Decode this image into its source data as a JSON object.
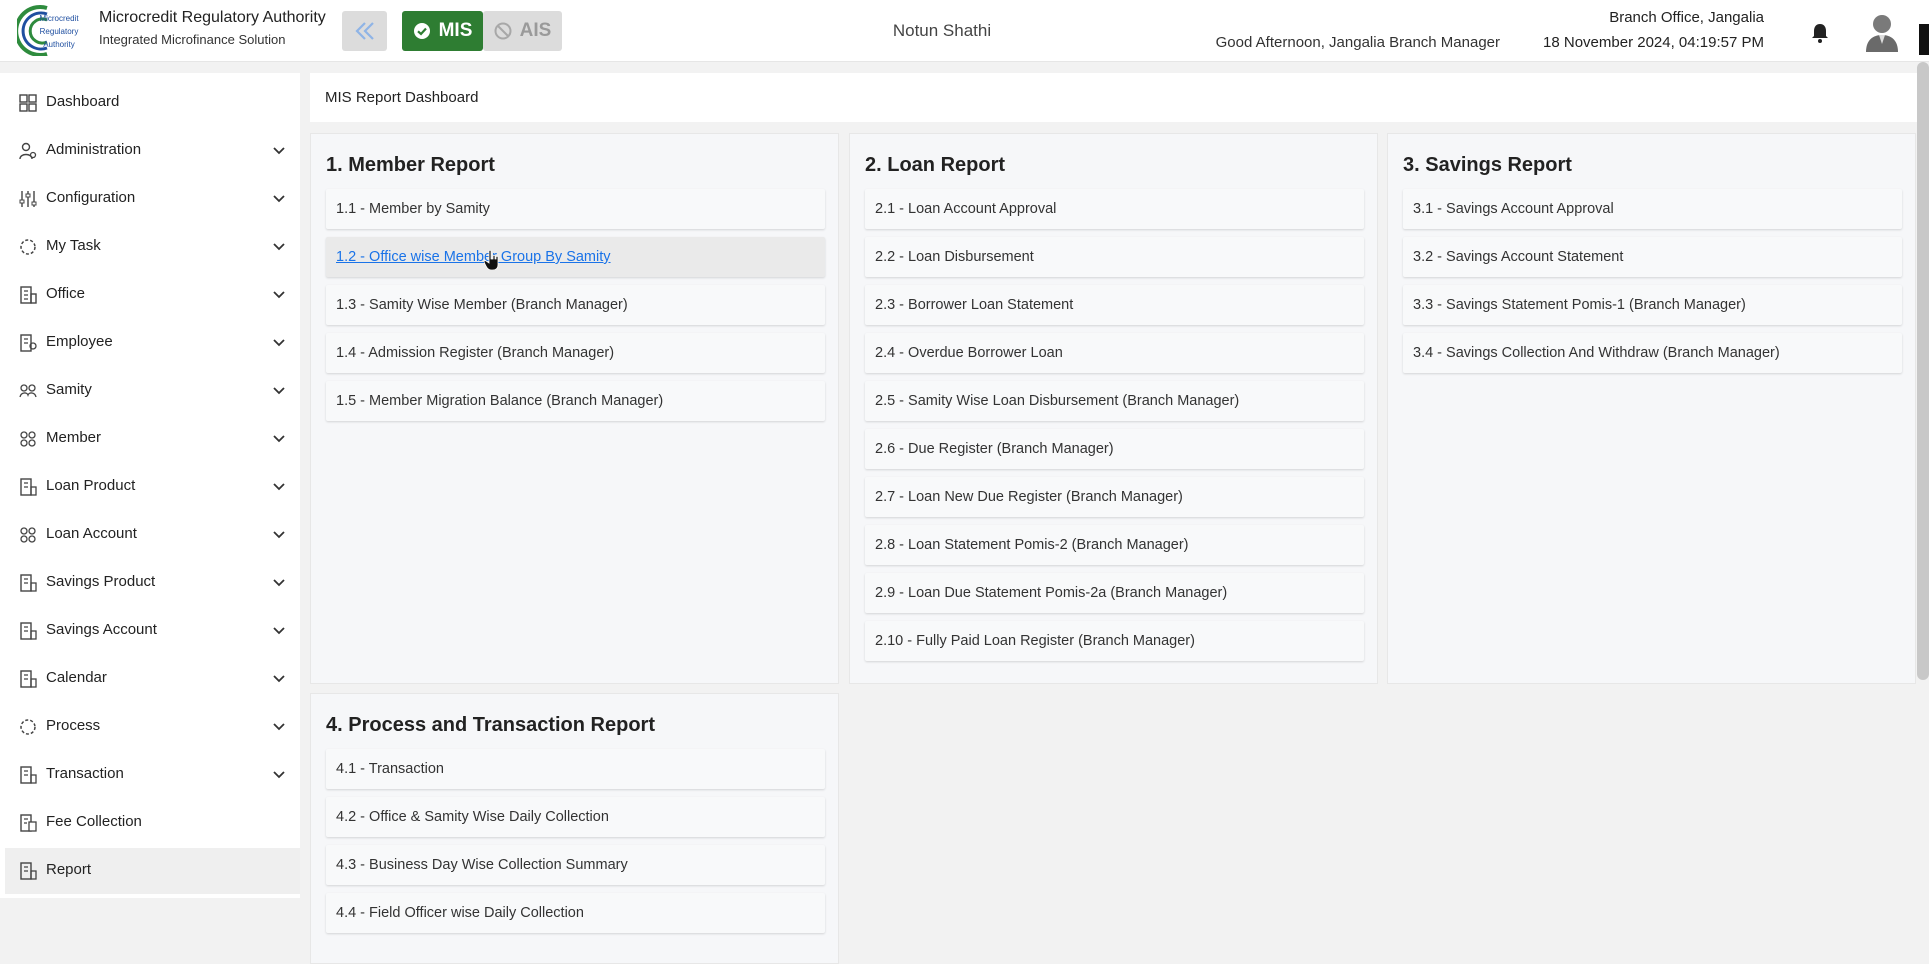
{
  "header": {
    "brand_title": "Microcredit Regulatory Authority",
    "brand_subtitle": "Integrated Microfinance Solution",
    "logo_text": "Microcredit Regulatory Authority",
    "mis_label": "MIS",
    "ais_label": "AIS",
    "org_name": "Notun Shathi",
    "greeting": "Good Afternoon, Jangalia Branch Manager",
    "branch_office": "Branch Office, Jangalia",
    "datetime": "18 November 2024, 04:19:57 PM",
    "icons": [
      "double-chevron-left-icon",
      "check-circle-icon",
      "ban-icon",
      "bell-icon",
      "user-avatar-icon"
    ],
    "colors": {
      "mis_active": "#2e7d32",
      "ais_inactive": "#dcdcdc",
      "logo_green": "#2e8b3d",
      "logo_blue": "#1f4fa0"
    }
  },
  "sidebar": {
    "items": [
      {
        "label": "Dashboard",
        "icon": "dashboard-icon",
        "expandable": false
      },
      {
        "label": "Administration",
        "icon": "admin-icon",
        "expandable": true
      },
      {
        "label": "Configuration",
        "icon": "sliders-icon",
        "expandable": true
      },
      {
        "label": "My Task",
        "icon": "task-icon",
        "expandable": true
      },
      {
        "label": "Office",
        "icon": "office-icon",
        "expandable": true
      },
      {
        "label": "Employee",
        "icon": "employee-icon",
        "expandable": true
      },
      {
        "label": "Samity",
        "icon": "samity-icon",
        "expandable": true
      },
      {
        "label": "Member",
        "icon": "member-icon",
        "expandable": true
      },
      {
        "label": "Loan Product",
        "icon": "loan-product-icon",
        "expandable": true
      },
      {
        "label": "Loan Account",
        "icon": "loan-account-icon",
        "expandable": true
      },
      {
        "label": "Savings Product",
        "icon": "savings-product-icon",
        "expandable": true
      },
      {
        "label": "Savings Account",
        "icon": "savings-account-icon",
        "expandable": true
      },
      {
        "label": "Calendar",
        "icon": "calendar-icon",
        "expandable": true
      },
      {
        "label": "Process",
        "icon": "process-icon",
        "expandable": true
      },
      {
        "label": "Transaction",
        "icon": "transaction-icon",
        "expandable": true
      },
      {
        "label": "Fee Collection",
        "icon": "fee-icon",
        "expandable": false
      },
      {
        "label": "Report",
        "icon": "report-icon",
        "expandable": false,
        "active": true
      }
    ]
  },
  "main": {
    "page_title": "MIS Report Dashboard",
    "panels": [
      {
        "title": "1. Member Report",
        "items": [
          "1.1 - Member by Samity",
          "1.2 - Office wise Member Group By Samity",
          "1.3 - Samity Wise Member (Branch Manager)",
          "1.4 - Admission Register (Branch Manager)",
          "1.5 - Member Migration Balance (Branch Manager)"
        ]
      },
      {
        "title": "2. Loan Report",
        "items": [
          "2.1 - Loan Account Approval",
          "2.2 - Loan Disbursement",
          "2.3 - Borrower Loan Statement",
          "2.4 - Overdue Borrower Loan",
          "2.5 - Samity Wise Loan Disbursement (Branch Manager)",
          "2.6 - Due Register (Branch Manager)",
          "2.7 - Loan New Due Register (Branch Manager)",
          "2.8 - Loan Statement Pomis-2 (Branch Manager)",
          "2.9 - Loan Due Statement Pomis-2a (Branch Manager)",
          "2.10 - Fully Paid Loan Register (Branch Manager)"
        ]
      },
      {
        "title": "3. Savings Report",
        "items": [
          "3.1 - Savings Account Approval",
          "3.2 - Savings Account Statement",
          "3.3 - Savings Statement Pomis-1 (Branch Manager)",
          "3.4 - Savings Collection And Withdraw (Branch Manager)"
        ]
      },
      {
        "title": "4. Process and Transaction Report",
        "items": [
          "4.1 - Transaction",
          "4.2 - Office & Samity Wise Daily Collection",
          "4.3 - Business Day Wise Collection Summary",
          "4.4 - Field Officer wise Daily Collection"
        ]
      }
    ]
  }
}
